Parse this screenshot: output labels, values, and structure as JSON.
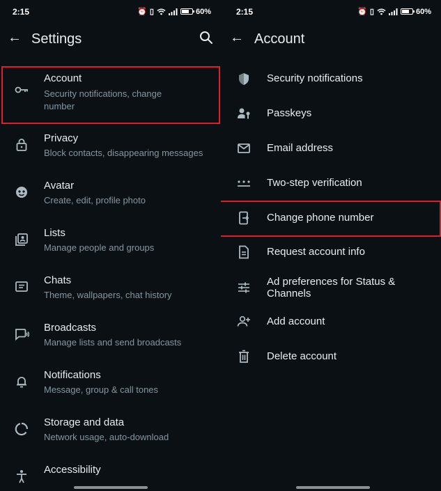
{
  "status": {
    "time": "2:15",
    "battery": "60%"
  },
  "left": {
    "title": "Settings",
    "items": [
      {
        "label": "Account",
        "subtitle": "Security notifications, change number",
        "icon": "key-icon"
      },
      {
        "label": "Privacy",
        "subtitle": "Block contacts, disappearing messages",
        "icon": "lock-icon"
      },
      {
        "label": "Avatar",
        "subtitle": "Create, edit, profile photo",
        "icon": "avatar-face-icon"
      },
      {
        "label": "Lists",
        "subtitle": "Manage people and groups",
        "icon": "lists-icon"
      },
      {
        "label": "Chats",
        "subtitle": "Theme, wallpapers, chat history",
        "icon": "chat-icon"
      },
      {
        "label": "Broadcasts",
        "subtitle": "Manage lists and send broadcasts",
        "icon": "broadcast-icon"
      },
      {
        "label": "Notifications",
        "subtitle": "Message, group & call tones",
        "icon": "bell-icon"
      },
      {
        "label": "Storage and data",
        "subtitle": "Network usage, auto-download",
        "icon": "storage-icon"
      },
      {
        "label": "Accessibility",
        "subtitle": "",
        "icon": "accessibility-icon"
      }
    ]
  },
  "right": {
    "title": "Account",
    "items": [
      {
        "label": "Security notifications",
        "icon": "shield-icon"
      },
      {
        "label": "Passkeys",
        "icon": "passkey-icon"
      },
      {
        "label": "Email address",
        "icon": "mail-icon"
      },
      {
        "label": "Two-step verification",
        "icon": "dots-icon"
      },
      {
        "label": "Change phone number",
        "icon": "phone-change-icon"
      },
      {
        "label": "Request account info",
        "icon": "document-icon"
      },
      {
        "label": "Ad preferences for Status & Channels",
        "icon": "sliders-icon"
      },
      {
        "label": "Add account",
        "icon": "add-person-icon"
      },
      {
        "label": "Delete account",
        "icon": "trash-icon"
      }
    ]
  }
}
